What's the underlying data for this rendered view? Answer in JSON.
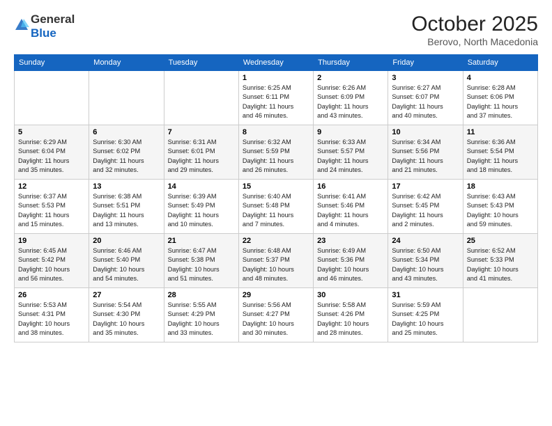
{
  "header": {
    "logo_general": "General",
    "logo_blue": "Blue",
    "month_title": "October 2025",
    "subtitle": "Berovo, North Macedonia"
  },
  "weekdays": [
    "Sunday",
    "Monday",
    "Tuesday",
    "Wednesday",
    "Thursday",
    "Friday",
    "Saturday"
  ],
  "weeks": [
    [
      {
        "day": "",
        "info": ""
      },
      {
        "day": "",
        "info": ""
      },
      {
        "day": "",
        "info": ""
      },
      {
        "day": "1",
        "info": "Sunrise: 6:25 AM\nSunset: 6:11 PM\nDaylight: 11 hours\nand 46 minutes."
      },
      {
        "day": "2",
        "info": "Sunrise: 6:26 AM\nSunset: 6:09 PM\nDaylight: 11 hours\nand 43 minutes."
      },
      {
        "day": "3",
        "info": "Sunrise: 6:27 AM\nSunset: 6:07 PM\nDaylight: 11 hours\nand 40 minutes."
      },
      {
        "day": "4",
        "info": "Sunrise: 6:28 AM\nSunset: 6:06 PM\nDaylight: 11 hours\nand 37 minutes."
      }
    ],
    [
      {
        "day": "5",
        "info": "Sunrise: 6:29 AM\nSunset: 6:04 PM\nDaylight: 11 hours\nand 35 minutes."
      },
      {
        "day": "6",
        "info": "Sunrise: 6:30 AM\nSunset: 6:02 PM\nDaylight: 11 hours\nand 32 minutes."
      },
      {
        "day": "7",
        "info": "Sunrise: 6:31 AM\nSunset: 6:01 PM\nDaylight: 11 hours\nand 29 minutes."
      },
      {
        "day": "8",
        "info": "Sunrise: 6:32 AM\nSunset: 5:59 PM\nDaylight: 11 hours\nand 26 minutes."
      },
      {
        "day": "9",
        "info": "Sunrise: 6:33 AM\nSunset: 5:57 PM\nDaylight: 11 hours\nand 24 minutes."
      },
      {
        "day": "10",
        "info": "Sunrise: 6:34 AM\nSunset: 5:56 PM\nDaylight: 11 hours\nand 21 minutes."
      },
      {
        "day": "11",
        "info": "Sunrise: 6:36 AM\nSunset: 5:54 PM\nDaylight: 11 hours\nand 18 minutes."
      }
    ],
    [
      {
        "day": "12",
        "info": "Sunrise: 6:37 AM\nSunset: 5:53 PM\nDaylight: 11 hours\nand 15 minutes."
      },
      {
        "day": "13",
        "info": "Sunrise: 6:38 AM\nSunset: 5:51 PM\nDaylight: 11 hours\nand 13 minutes."
      },
      {
        "day": "14",
        "info": "Sunrise: 6:39 AM\nSunset: 5:49 PM\nDaylight: 11 hours\nand 10 minutes."
      },
      {
        "day": "15",
        "info": "Sunrise: 6:40 AM\nSunset: 5:48 PM\nDaylight: 11 hours\nand 7 minutes."
      },
      {
        "day": "16",
        "info": "Sunrise: 6:41 AM\nSunset: 5:46 PM\nDaylight: 11 hours\nand 4 minutes."
      },
      {
        "day": "17",
        "info": "Sunrise: 6:42 AM\nSunset: 5:45 PM\nDaylight: 11 hours\nand 2 minutes."
      },
      {
        "day": "18",
        "info": "Sunrise: 6:43 AM\nSunset: 5:43 PM\nDaylight: 10 hours\nand 59 minutes."
      }
    ],
    [
      {
        "day": "19",
        "info": "Sunrise: 6:45 AM\nSunset: 5:42 PM\nDaylight: 10 hours\nand 56 minutes."
      },
      {
        "day": "20",
        "info": "Sunrise: 6:46 AM\nSunset: 5:40 PM\nDaylight: 10 hours\nand 54 minutes."
      },
      {
        "day": "21",
        "info": "Sunrise: 6:47 AM\nSunset: 5:38 PM\nDaylight: 10 hours\nand 51 minutes."
      },
      {
        "day": "22",
        "info": "Sunrise: 6:48 AM\nSunset: 5:37 PM\nDaylight: 10 hours\nand 48 minutes."
      },
      {
        "day": "23",
        "info": "Sunrise: 6:49 AM\nSunset: 5:36 PM\nDaylight: 10 hours\nand 46 minutes."
      },
      {
        "day": "24",
        "info": "Sunrise: 6:50 AM\nSunset: 5:34 PM\nDaylight: 10 hours\nand 43 minutes."
      },
      {
        "day": "25",
        "info": "Sunrise: 6:52 AM\nSunset: 5:33 PM\nDaylight: 10 hours\nand 41 minutes."
      }
    ],
    [
      {
        "day": "26",
        "info": "Sunrise: 5:53 AM\nSunset: 4:31 PM\nDaylight: 10 hours\nand 38 minutes."
      },
      {
        "day": "27",
        "info": "Sunrise: 5:54 AM\nSunset: 4:30 PM\nDaylight: 10 hours\nand 35 minutes."
      },
      {
        "day": "28",
        "info": "Sunrise: 5:55 AM\nSunset: 4:29 PM\nDaylight: 10 hours\nand 33 minutes."
      },
      {
        "day": "29",
        "info": "Sunrise: 5:56 AM\nSunset: 4:27 PM\nDaylight: 10 hours\nand 30 minutes."
      },
      {
        "day": "30",
        "info": "Sunrise: 5:58 AM\nSunset: 4:26 PM\nDaylight: 10 hours\nand 28 minutes."
      },
      {
        "day": "31",
        "info": "Sunrise: 5:59 AM\nSunset: 4:25 PM\nDaylight: 10 hours\nand 25 minutes."
      },
      {
        "day": "",
        "info": ""
      }
    ]
  ]
}
